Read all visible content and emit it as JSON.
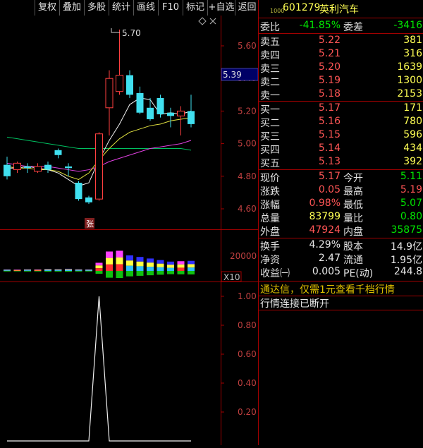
{
  "toolbar": {
    "buttons": [
      "复权",
      "叠加",
      "多股",
      "统计",
      "画线",
      "F10",
      "标记",
      "+自选",
      "返回"
    ]
  },
  "chart": {
    "price_axis": [
      "5.60",
      "5.40",
      "5.20",
      "5.00",
      "4.80",
      "4.60"
    ],
    "current_price_tag": "5.39",
    "high_annotation": "5.70",
    "zhang_marker": "张",
    "volume_axis": "20000",
    "volume_unit": "X10",
    "indicator_axis": [
      "1.00",
      "0.80",
      "0.60",
      "0.40",
      "0.20"
    ],
    "settings_icon": "diamond-icon",
    "close_icon": "close-icon"
  },
  "chart_data": [
    {
      "type": "candlestick",
      "ylim": [
        4.55,
        5.72
      ],
      "candles": [
        {
          "o": 4.87,
          "c": 4.8,
          "h": 4.92,
          "l": 4.78
        },
        {
          "o": 4.84,
          "c": 4.88,
          "h": 4.89,
          "l": 4.82
        },
        {
          "o": 4.86,
          "c": 4.85,
          "h": 4.88,
          "l": 4.82
        },
        {
          "o": 4.83,
          "c": 4.86,
          "h": 4.88,
          "l": 4.82
        },
        {
          "o": 4.87,
          "c": 4.84,
          "h": 4.89,
          "l": 4.82
        },
        {
          "o": 4.96,
          "c": 4.93,
          "h": 4.97,
          "l": 4.91
        },
        {
          "o": 4.86,
          "c": 4.85,
          "h": 4.88,
          "l": 4.8
        },
        {
          "o": 4.76,
          "c": 4.66,
          "h": 4.77,
          "l": 4.65
        },
        {
          "o": 4.67,
          "c": 4.64,
          "h": 4.68,
          "l": 4.63
        },
        {
          "o": 4.66,
          "c": 5.06,
          "h": 5.07,
          "l": 4.65
        },
        {
          "o": 5.22,
          "c": 5.4,
          "h": 5.45,
          "l": 5.05
        },
        {
          "o": 5.32,
          "c": 5.42,
          "h": 5.7,
          "l": 5.3
        },
        {
          "o": 5.42,
          "c": 5.3,
          "h": 5.45,
          "l": 5.28
        },
        {
          "o": 5.31,
          "c": 5.19,
          "h": 5.35,
          "l": 5.18
        },
        {
          "o": 5.22,
          "c": 5.15,
          "h": 5.28,
          "l": 5.14
        },
        {
          "o": 5.28,
          "c": 5.18,
          "h": 5.3,
          "l": 5.16
        },
        {
          "o": 5.19,
          "c": 5.17,
          "h": 5.22,
          "l": 5.1
        },
        {
          "o": 5.17,
          "c": 5.2,
          "h": 5.23,
          "l": 5.05
        },
        {
          "o": 5.2,
          "c": 5.12,
          "h": 5.3,
          "l": 5.1
        }
      ],
      "ma5": [
        4.85,
        4.85,
        4.86,
        4.85,
        4.84,
        4.82,
        4.78,
        4.74,
        4.76,
        4.9,
        5.02,
        5.12,
        5.24,
        5.28,
        5.27,
        5.18,
        5.19,
        5.18,
        5.2
      ],
      "ma10": [
        4.86,
        4.85,
        4.85,
        4.84,
        4.84,
        4.83,
        4.8,
        4.78,
        4.82,
        4.9,
        4.97,
        5.03,
        5.07,
        5.09,
        5.11,
        5.12,
        5.14,
        5.15,
        5.16
      ],
      "ma20": [
        5.04,
        5.03,
        5.02,
        5.01,
        5.0,
        4.99,
        4.98,
        4.97,
        4.97,
        4.97,
        4.97,
        4.97,
        4.97,
        4.97,
        4.97,
        4.97,
        4.97,
        4.97,
        4.96
      ],
      "ma60": [
        4.88,
        4.87,
        4.86,
        4.86,
        4.86,
        4.85,
        4.84,
        4.83,
        4.84,
        4.86,
        4.89,
        4.91,
        4.93,
        4.95,
        4.97,
        4.98,
        4.99,
        5.0,
        5.02
      ]
    },
    {
      "type": "bar",
      "ylim": [
        0,
        40000
      ],
      "values": [
        2000,
        1600,
        2200,
        1800,
        2600,
        2400,
        2800,
        2200,
        2000,
        10500,
        25000,
        26000,
        20000,
        18000,
        16000,
        14000,
        12000,
        12500,
        13000
      ]
    },
    {
      "type": "line",
      "ylim": [
        0,
        1.0
      ],
      "values": [
        0,
        0,
        0,
        0,
        0,
        0,
        0,
        0,
        0,
        1,
        0,
        0,
        0,
        0,
        0,
        0,
        0,
        0,
        0
      ]
    }
  ],
  "quote": {
    "code_prefix": "1000",
    "code": "601279",
    "name": "英利汽车",
    "weibi_label": "委比",
    "weibi": "-41.85%",
    "weicha_label": "委差",
    "weicha": "-3416",
    "sell": [
      {
        "label": "卖五",
        "price": "5.22",
        "vol": "381"
      },
      {
        "label": "卖四",
        "price": "5.21",
        "vol": "316"
      },
      {
        "label": "卖三",
        "price": "5.20",
        "vol": "1639"
      },
      {
        "label": "卖二",
        "price": "5.19",
        "vol": "1300"
      },
      {
        "label": "卖一",
        "price": "5.18",
        "vol": "2153"
      }
    ],
    "buy": [
      {
        "label": "买一",
        "price": "5.17",
        "vol": "171"
      },
      {
        "label": "买二",
        "price": "5.16",
        "vol": "780"
      },
      {
        "label": "买三",
        "price": "5.15",
        "vol": "596"
      },
      {
        "label": "买四",
        "price": "5.14",
        "vol": "434"
      },
      {
        "label": "买五",
        "price": "5.13",
        "vol": "392"
      }
    ],
    "stats": [
      {
        "l1": "现价",
        "v1": "5.17",
        "l2": "今开",
        "v2": "5.11"
      },
      {
        "l1": "涨跌",
        "v1": "0.05",
        "l2": "最高",
        "v2": "5.19"
      },
      {
        "l1": "涨幅",
        "v1": "0.98%",
        "l2": "最低",
        "v2": "5.07"
      },
      {
        "l1": "总量",
        "v1": "83799",
        "l2": "量比",
        "v2": "0.80"
      },
      {
        "l1": "外盘",
        "v1": "47924",
        "l2": "内盘",
        "v2": "35875"
      }
    ],
    "fin": [
      {
        "l1": "换手",
        "v1": "4.29%",
        "l2": "股本",
        "v2": "14.9亿"
      },
      {
        "l1": "净资",
        "v1": "2.47",
        "l2": "流通",
        "v2": "1.95亿"
      },
      {
        "l1": "收益㈠",
        "v1": "0.005",
        "l2": "PE(动)",
        "v2": "244.8"
      }
    ],
    "notice1": "通达信，仅需1元查看千档行情",
    "notice2": "行情连接已断开"
  }
}
